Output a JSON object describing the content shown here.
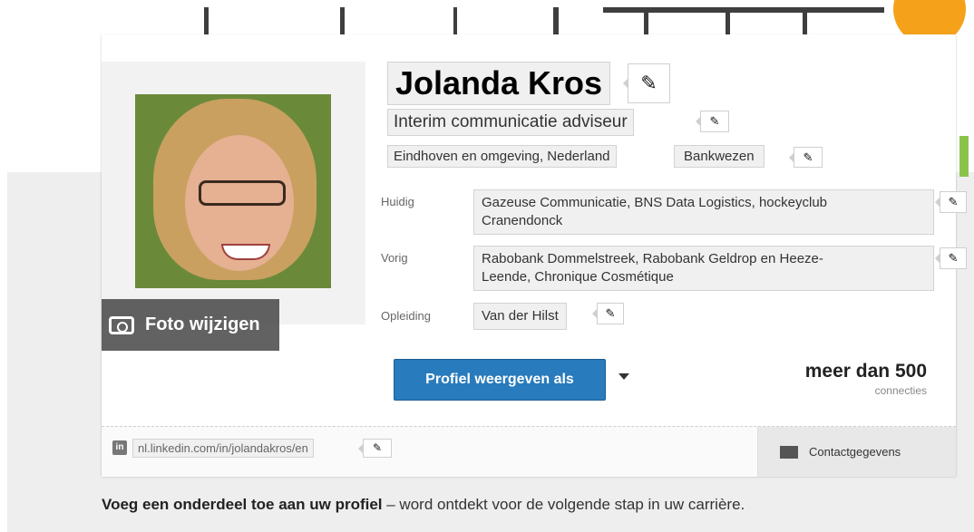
{
  "profile": {
    "name": "Jolanda Kros",
    "headline": "Interim communicatie adviseur",
    "location": "Eindhoven en omgeving, Nederland",
    "industry": "Bankwezen",
    "photo_button_label": "Foto wijzigen"
  },
  "details": {
    "current_label": "Huidig",
    "current_value_line1": "Gazeuse Communicatie, BNS Data Logistics, hockeyclub",
    "current_value_line2": "Cranendonck",
    "previous_label": "Vorig",
    "previous_value_line1": "Rabobank Dommelstreek, Rabobank Geldrop en Heeze-",
    "previous_value_line2": "Leende, Chronique Cosmétique",
    "education_label": "Opleiding",
    "education_value": "Van der Hilst"
  },
  "actions": {
    "view_profile_as": "Profiel weergeven als"
  },
  "connections": {
    "count": "meer dan 500",
    "label": "connecties"
  },
  "footer": {
    "profile_url": "nl.linkedin.com/in/jolandakros/en",
    "contact_info": "Contactgegevens",
    "linkedin_icon_text": "in"
  },
  "prompt": {
    "bold": "Voeg een onderdeel toe aan uw profiel",
    "rest": " – word ontdekt voor de volgende stap in uw carrière."
  },
  "colors": {
    "primary_button": "#287bbc",
    "background": "#eeeeee"
  },
  "icons": {
    "edit": "pencil-icon",
    "camera": "camera-icon",
    "linkedin": "linkedin-icon",
    "contact": "contact-card-icon",
    "dropdown": "caret-down-icon"
  }
}
